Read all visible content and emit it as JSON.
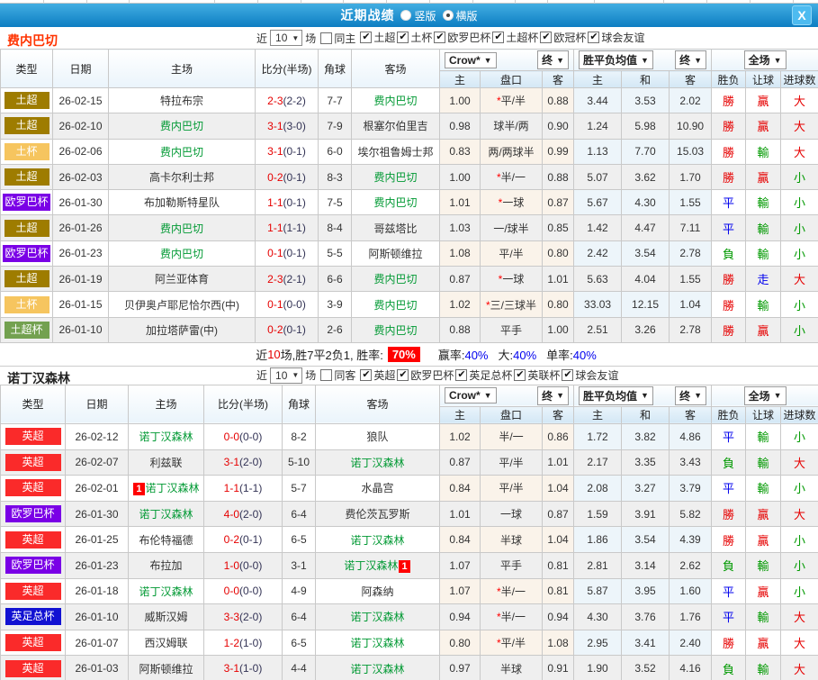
{
  "titlebar": {
    "title": "近期战绩",
    "option_vertical": "竖版",
    "option_horizontal": "横版",
    "close_label": "X"
  },
  "filter_common": {
    "near": "近",
    "count": "10",
    "unit": "场"
  },
  "table_columns": {
    "type": "类型",
    "date": "日期",
    "home": "主场",
    "score": "比分(半场)",
    "corner": "角球",
    "away": "客场",
    "odds_home": "主",
    "odds_handicap": "盘口",
    "odds_away": "客",
    "avg_win": "主",
    "avg_draw": "和",
    "avg_lose": "客",
    "result_outcome": "胜负",
    "result_handicap": "让球",
    "result_total": "进球数",
    "dropdown_crow": "Crow*",
    "dropdown_final1": "终",
    "dropdown_avg": "胜平负均值",
    "dropdown_final2": "终",
    "dropdown_fulltime": "全场"
  },
  "sectionA": {
    "team": "费内巴切",
    "team_color": "#FF3300",
    "same_label": "同主",
    "leagues": [
      "土超",
      "土杯",
      "欧罗巴杯",
      "土超杯",
      "欧冠杯",
      "球会友谊"
    ],
    "rows": [
      {
        "league": "土超",
        "league_bg": "#9E7C00",
        "date": "26-02-15",
        "home": "特拉布宗",
        "home_color": "#333333",
        "home_card": "",
        "score": "2-3",
        "half": "(2-2)",
        "corner": "7-7",
        "away": "费内巴切",
        "away_color": "#009933",
        "away_card": "",
        "o1": "1.00",
        "star": "*",
        "pan": "平/半",
        "o2": "0.88",
        "a1": "3.44",
        "a2": "3.53",
        "a3": "2.02",
        "r1": "勝",
        "r1c": "#E60000",
        "r2": "贏",
        "r2c": "#E60000",
        "r3": "大",
        "r3c": "#E60000"
      },
      {
        "league": "土超",
        "league_bg": "#9E7C00",
        "date": "26-02-10",
        "home": "费内巴切",
        "home_color": "#009933",
        "home_card": "",
        "score": "3-1",
        "half": "(3-0)",
        "corner": "7-9",
        "away": "根塞尔伯里吉",
        "away_color": "#333333",
        "away_card": "",
        "o1": "0.98",
        "star": "",
        "pan": "球半/两",
        "o2": "0.90",
        "a1": "1.24",
        "a2": "5.98",
        "a3": "10.90",
        "r1": "勝",
        "r1c": "#E60000",
        "r2": "贏",
        "r2c": "#E60000",
        "r3": "大",
        "r3c": "#E60000"
      },
      {
        "league": "土杯",
        "league_bg": "#F6C55F",
        "date": "26-02-06",
        "home": "费内巴切",
        "home_color": "#009933",
        "home_card": "",
        "score": "3-1",
        "half": "(0-1)",
        "corner": "6-0",
        "away": "埃尔祖鲁姆士邦",
        "away_color": "#333333",
        "away_card": "",
        "o1": "0.83",
        "star": "",
        "pan": "两/两球半",
        "o2": "0.99",
        "a1": "1.13",
        "a2": "7.70",
        "a3": "15.03",
        "r1": "勝",
        "r1c": "#E60000",
        "r2": "輸",
        "r2c": "#009900",
        "r3": "大",
        "r3c": "#E60000"
      },
      {
        "league": "土超",
        "league_bg": "#9E7C00",
        "date": "26-02-03",
        "home": "高卡尔利士邦",
        "home_color": "#333333",
        "home_card": "",
        "score": "0-2",
        "half": "(0-1)",
        "corner": "8-3",
        "away": "费内巴切",
        "away_color": "#009933",
        "away_card": "",
        "o1": "1.00",
        "star": "*",
        "pan": "半/一",
        "o2": "0.88",
        "a1": "5.07",
        "a2": "3.62",
        "a3": "1.70",
        "r1": "勝",
        "r1c": "#E60000",
        "r2": "贏",
        "r2c": "#E60000",
        "r3": "小",
        "r3c": "#009900"
      },
      {
        "league": "欧罗巴杯",
        "league_bg": "#7A00E6",
        "date": "26-01-30",
        "home": "布加勒斯特星队",
        "home_color": "#333333",
        "home_card": "",
        "score": "1-1",
        "half": "(0-1)",
        "corner": "7-5",
        "away": "费内巴切",
        "away_color": "#009933",
        "away_card": "",
        "o1": "1.01",
        "star": "*",
        "pan": "一球",
        "o2": "0.87",
        "a1": "5.67",
        "a2": "4.30",
        "a3": "1.55",
        "r1": "平",
        "r1c": "#0000EE",
        "r2": "輸",
        "r2c": "#009900",
        "r3": "小",
        "r3c": "#009900"
      },
      {
        "league": "土超",
        "league_bg": "#9E7C00",
        "date": "26-01-26",
        "home": "费内巴切",
        "home_color": "#009933",
        "home_card": "",
        "score": "1-1",
        "half": "(1-1)",
        "corner": "8-4",
        "away": "哥兹塔比",
        "away_color": "#333333",
        "away_card": "",
        "o1": "1.03",
        "star": "",
        "pan": "一/球半",
        "o2": "0.85",
        "a1": "1.42",
        "a2": "4.47",
        "a3": "7.11",
        "r1": "平",
        "r1c": "#0000EE",
        "r2": "輸",
        "r2c": "#009900",
        "r3": "小",
        "r3c": "#009900"
      },
      {
        "league": "欧罗巴杯",
        "league_bg": "#7A00E6",
        "date": "26-01-23",
        "home": "费内巴切",
        "home_color": "#009933",
        "home_card": "",
        "score": "0-1",
        "half": "(0-1)",
        "corner": "5-5",
        "away": "阿斯顿维拉",
        "away_color": "#333333",
        "away_card": "",
        "o1": "1.08",
        "star": "",
        "pan": "平/半",
        "o2": "0.80",
        "a1": "2.42",
        "a2": "3.54",
        "a3": "2.78",
        "r1": "負",
        "r1c": "#009900",
        "r2": "輸",
        "r2c": "#009900",
        "r3": "小",
        "r3c": "#009900"
      },
      {
        "league": "土超",
        "league_bg": "#9E7C00",
        "date": "26-01-19",
        "home": "阿兰亚体育",
        "home_color": "#333333",
        "home_card": "",
        "score": "2-3",
        "half": "(2-1)",
        "corner": "6-6",
        "away": "费内巴切",
        "away_color": "#009933",
        "away_card": "",
        "o1": "0.87",
        "star": "*",
        "pan": "一球",
        "o2": "1.01",
        "a1": "5.63",
        "a2": "4.04",
        "a3": "1.55",
        "r1": "勝",
        "r1c": "#E60000",
        "r2": "走",
        "r2c": "#0000EE",
        "r3": "大",
        "r3c": "#E60000"
      },
      {
        "league": "土杯",
        "league_bg": "#F6C55F",
        "date": "26-01-15",
        "home": "贝伊奥卢耶尼恰尔西(中)",
        "home_color": "#333333",
        "home_card": "",
        "score": "0-1",
        "half": "(0-0)",
        "corner": "3-9",
        "away": "费内巴切",
        "away_color": "#009933",
        "away_card": "",
        "o1": "1.02",
        "star": "*",
        "pan": "三/三球半",
        "o2": "0.80",
        "a1": "33.03",
        "a2": "12.15",
        "a3": "1.04",
        "r1": "勝",
        "r1c": "#E60000",
        "r2": "輸",
        "r2c": "#009900",
        "r3": "小",
        "r3c": "#009900"
      },
      {
        "league": "土超杯",
        "league_bg": "#73A150",
        "date": "26-01-10",
        "home": "加拉塔萨雷(中)",
        "home_color": "#333333",
        "home_card": "",
        "score": "0-2",
        "half": "(0-1)",
        "corner": "2-6",
        "away": "费内巴切",
        "away_color": "#009933",
        "away_card": "",
        "o1": "0.88",
        "star": "",
        "pan": "平手",
        "o2": "1.00",
        "a1": "2.51",
        "a2": "3.26",
        "a3": "2.78",
        "r1": "勝",
        "r1c": "#E60000",
        "r2": "贏",
        "r2c": "#E60000",
        "r3": "小",
        "r3c": "#009900"
      }
    ],
    "summary": {
      "lead": "近",
      "count": "10",
      "tail": "场,胜7平2负1, 胜率:",
      "rate": "70%",
      "stats": [
        {
          "label": "赢率:",
          "value": "40%"
        },
        {
          "label": "大:",
          "value": "40%"
        },
        {
          "label": "单率:",
          "value": "40%"
        }
      ]
    }
  },
  "sectionB": {
    "team": "诺丁汉森林",
    "team_color": "#222222",
    "same_label": "同客",
    "leagues": [
      "英超",
      "欧罗巴杯",
      "英足总杯",
      "英联杯",
      "球会友谊"
    ],
    "rows": [
      {
        "league": "英超",
        "league_bg": "#FA2A2A",
        "date": "26-02-12",
        "home": "诺丁汉森林",
        "home_color": "#009933",
        "home_card": "",
        "score": "0-0",
        "half": "(0-0)",
        "corner": "8-2",
        "away": "狼队",
        "away_color": "#333333",
        "away_card": "",
        "o1": "1.02",
        "star": "",
        "pan": "半/一",
        "o2": "0.86",
        "a1": "1.72",
        "a2": "3.82",
        "a3": "4.86",
        "r1": "平",
        "r1c": "#0000EE",
        "r2": "輸",
        "r2c": "#009900",
        "r3": "小",
        "r3c": "#009900"
      },
      {
        "league": "英超",
        "league_bg": "#FA2A2A",
        "date": "26-02-07",
        "home": "利兹联",
        "home_color": "#333333",
        "home_card": "",
        "score": "3-1",
        "half": "(2-0)",
        "corner": "5-10",
        "away": "诺丁汉森林",
        "away_color": "#009933",
        "away_card": "",
        "o1": "0.87",
        "star": "",
        "pan": "平/半",
        "o2": "1.01",
        "a1": "2.17",
        "a2": "3.35",
        "a3": "3.43",
        "r1": "負",
        "r1c": "#009900",
        "r2": "輸",
        "r2c": "#009900",
        "r3": "大",
        "r3c": "#E60000"
      },
      {
        "league": "英超",
        "league_bg": "#FA2A2A",
        "date": "26-02-01",
        "home": "诺丁汉森林",
        "home_color": "#009933",
        "home_card": "1",
        "score": "1-1",
        "half": "(1-1)",
        "corner": "5-7",
        "away": "水晶宫",
        "away_color": "#333333",
        "away_card": "",
        "o1": "0.84",
        "star": "",
        "pan": "平/半",
        "o2": "1.04",
        "a1": "2.08",
        "a2": "3.27",
        "a3": "3.79",
        "r1": "平",
        "r1c": "#0000EE",
        "r2": "輸",
        "r2c": "#009900",
        "r3": "小",
        "r3c": "#009900"
      },
      {
        "league": "欧罗巴杯",
        "league_bg": "#7A00E6",
        "date": "26-01-30",
        "home": "诺丁汉森林",
        "home_color": "#009933",
        "home_card": "",
        "score": "4-0",
        "half": "(2-0)",
        "corner": "6-4",
        "away": "费伦茨瓦罗斯",
        "away_color": "#333333",
        "away_card": "",
        "o1": "1.01",
        "star": "",
        "pan": "一球",
        "o2": "0.87",
        "a1": "1.59",
        "a2": "3.91",
        "a3": "5.82",
        "r1": "勝",
        "r1c": "#E60000",
        "r2": "贏",
        "r2c": "#E60000",
        "r3": "大",
        "r3c": "#E60000"
      },
      {
        "league": "英超",
        "league_bg": "#FA2A2A",
        "date": "26-01-25",
        "home": "布伦特福德",
        "home_color": "#333333",
        "home_card": "",
        "score": "0-2",
        "half": "(0-1)",
        "corner": "6-5",
        "away": "诺丁汉森林",
        "away_color": "#009933",
        "away_card": "",
        "o1": "0.84",
        "star": "",
        "pan": "半球",
        "o2": "1.04",
        "a1": "1.86",
        "a2": "3.54",
        "a3": "4.39",
        "r1": "勝",
        "r1c": "#E60000",
        "r2": "贏",
        "r2c": "#E60000",
        "r3": "小",
        "r3c": "#009900"
      },
      {
        "league": "欧罗巴杯",
        "league_bg": "#7A00E6",
        "date": "26-01-23",
        "home": "布拉加",
        "home_color": "#333333",
        "home_card": "",
        "score": "1-0",
        "half": "(0-0)",
        "corner": "3-1",
        "away": "诺丁汉森林",
        "away_color": "#009933",
        "away_card": "1",
        "o1": "1.07",
        "star": "",
        "pan": "平手",
        "o2": "0.81",
        "a1": "2.81",
        "a2": "3.14",
        "a3": "2.62",
        "r1": "負",
        "r1c": "#009900",
        "r2": "輸",
        "r2c": "#009900",
        "r3": "小",
        "r3c": "#009900"
      },
      {
        "league": "英超",
        "league_bg": "#FA2A2A",
        "date": "26-01-18",
        "home": "诺丁汉森林",
        "home_color": "#009933",
        "home_card": "",
        "score": "0-0",
        "half": "(0-0)",
        "corner": "4-9",
        "away": "阿森纳",
        "away_color": "#333333",
        "away_card": "",
        "o1": "1.07",
        "star": "*",
        "pan": "半/一",
        "o2": "0.81",
        "a1": "5.87",
        "a2": "3.95",
        "a3": "1.60",
        "r1": "平",
        "r1c": "#0000EE",
        "r2": "贏",
        "r2c": "#E60000",
        "r3": "小",
        "r3c": "#009900"
      },
      {
        "league": "英足总杯",
        "league_bg": "#1212D2",
        "date": "26-01-10",
        "home": "威斯汉姆",
        "home_color": "#333333",
        "home_card": "",
        "score": "3-3",
        "half": "(2-0)",
        "corner": "6-4",
        "away": "诺丁汉森林",
        "away_color": "#009933",
        "away_card": "",
        "o1": "0.94",
        "star": "*",
        "pan": "半/一",
        "o2": "0.94",
        "a1": "4.30",
        "a2": "3.76",
        "a3": "1.76",
        "r1": "平",
        "r1c": "#0000EE",
        "r2": "輸",
        "r2c": "#009900",
        "r3": "大",
        "r3c": "#E60000"
      },
      {
        "league": "英超",
        "league_bg": "#FA2A2A",
        "date": "26-01-07",
        "home": "西汉姆联",
        "home_color": "#333333",
        "home_card": "",
        "score": "1-2",
        "half": "(1-0)",
        "corner": "6-5",
        "away": "诺丁汉森林",
        "away_color": "#009933",
        "away_card": "",
        "o1": "0.80",
        "star": "*",
        "pan": "平/半",
        "o2": "1.08",
        "a1": "2.95",
        "a2": "3.41",
        "a3": "2.40",
        "r1": "勝",
        "r1c": "#E60000",
        "r2": "贏",
        "r2c": "#E60000",
        "r3": "大",
        "r3c": "#E60000"
      },
      {
        "league": "英超",
        "league_bg": "#FA2A2A",
        "date": "26-01-03",
        "home": "阿斯顿维拉",
        "home_color": "#333333",
        "home_card": "",
        "score": "3-1",
        "half": "(1-0)",
        "corner": "4-4",
        "away": "诺丁汉森林",
        "away_color": "#009933",
        "away_card": "",
        "o1": "0.97",
        "star": "",
        "pan": "半球",
        "o2": "0.91",
        "a1": "1.90",
        "a2": "3.52",
        "a3": "4.16",
        "r1": "負",
        "r1c": "#009900",
        "r2": "輸",
        "r2c": "#009900",
        "r3": "大",
        "r3c": "#E60000"
      }
    ]
  }
}
